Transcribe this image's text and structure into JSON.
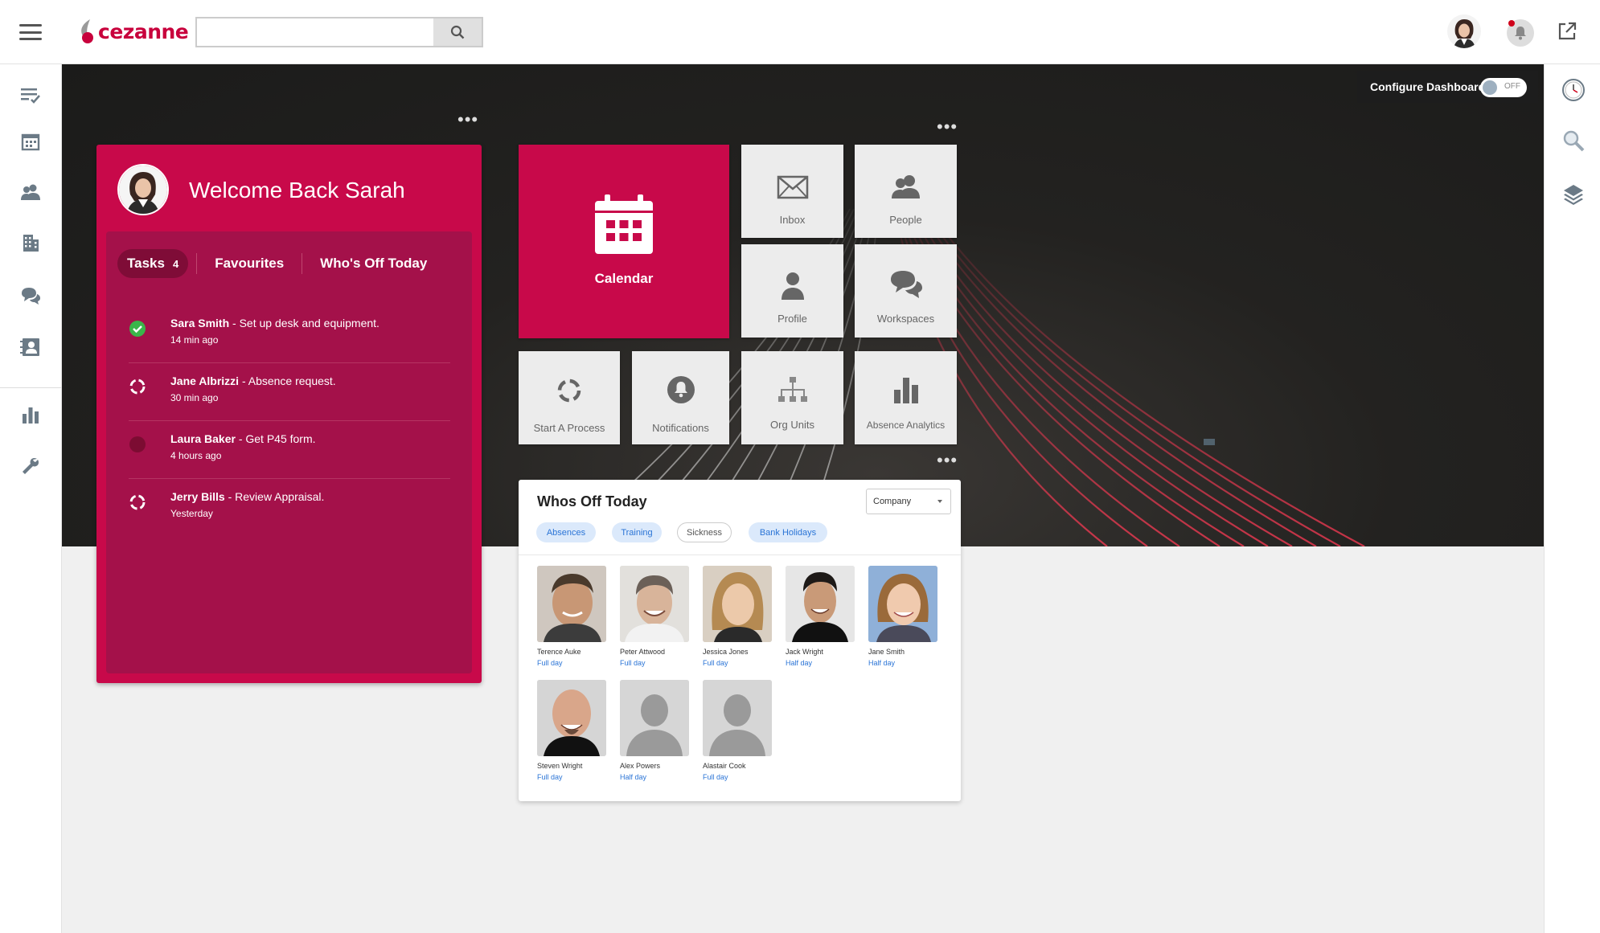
{
  "header": {
    "logo_text": "cezanne",
    "search_placeholder": ""
  },
  "dashboard": {
    "config_label": "Configure Dashboard",
    "toggle_label": "OFF"
  },
  "welcome": {
    "title": "Welcome Back Sarah",
    "tabs": [
      {
        "label": "Tasks",
        "count": "4"
      },
      {
        "label": "Favourites"
      },
      {
        "label": "Who's Off Today"
      }
    ],
    "tasks": [
      {
        "name": "Sara Smith",
        "action": " - Set up desk and equipment.",
        "time": "14 min ago",
        "status": "done"
      },
      {
        "name": "Jane Albrizzi",
        "action": " - Absence request.",
        "time": "30 min ago",
        "status": "in-progress"
      },
      {
        "name": "Laura Baker",
        "action": " - Get P45 form.",
        "time": "4 hours ago",
        "status": "pending"
      },
      {
        "name": "Jerry Bills",
        "action": " - Review Appraisal.",
        "time": "Yesterday",
        "status": "in-progress"
      }
    ]
  },
  "tiles": {
    "calendar": "Calendar",
    "inbox": "Inbox",
    "people": "People",
    "profile": "Profile",
    "workspaces": "Workspaces",
    "start_process": "Start A Process",
    "notifications": "Notifications",
    "org_units": "Org Units",
    "absence_analytics": "Absence Analytics"
  },
  "whos_off": {
    "title": "Whos Off Today",
    "filter_value": "Company",
    "chips": [
      "Absences",
      "Training",
      "Sickness",
      "Bank Holidays"
    ],
    "people": [
      {
        "name": "Terence Auke",
        "duration": "Full day"
      },
      {
        "name": "Peter Attwood",
        "duration": "Full day"
      },
      {
        "name": "Jessica Jones",
        "duration": "Full day"
      },
      {
        "name": "Jack Wright",
        "duration": "Half day"
      },
      {
        "name": "Jane Smith",
        "duration": "Half day"
      },
      {
        "name": "Steven Wright",
        "duration": "Full day"
      },
      {
        "name": "Alex Powers",
        "duration": "Half day"
      },
      {
        "name": "Alastair Cook",
        "duration": "Full day"
      }
    ]
  },
  "colors": {
    "brand": "#c8094a",
    "brand_dark": "#a4114a",
    "link_blue": "#2a74d6"
  },
  "icons": {
    "sidebar": [
      "tasks-icon",
      "calendar-icon",
      "people-icon",
      "building-icon",
      "chat-icon",
      "contacts-icon",
      "bar-chart-icon",
      "wrench-icon"
    ],
    "rightbar": [
      "clock-icon",
      "search-icon",
      "layers-icon"
    ]
  }
}
